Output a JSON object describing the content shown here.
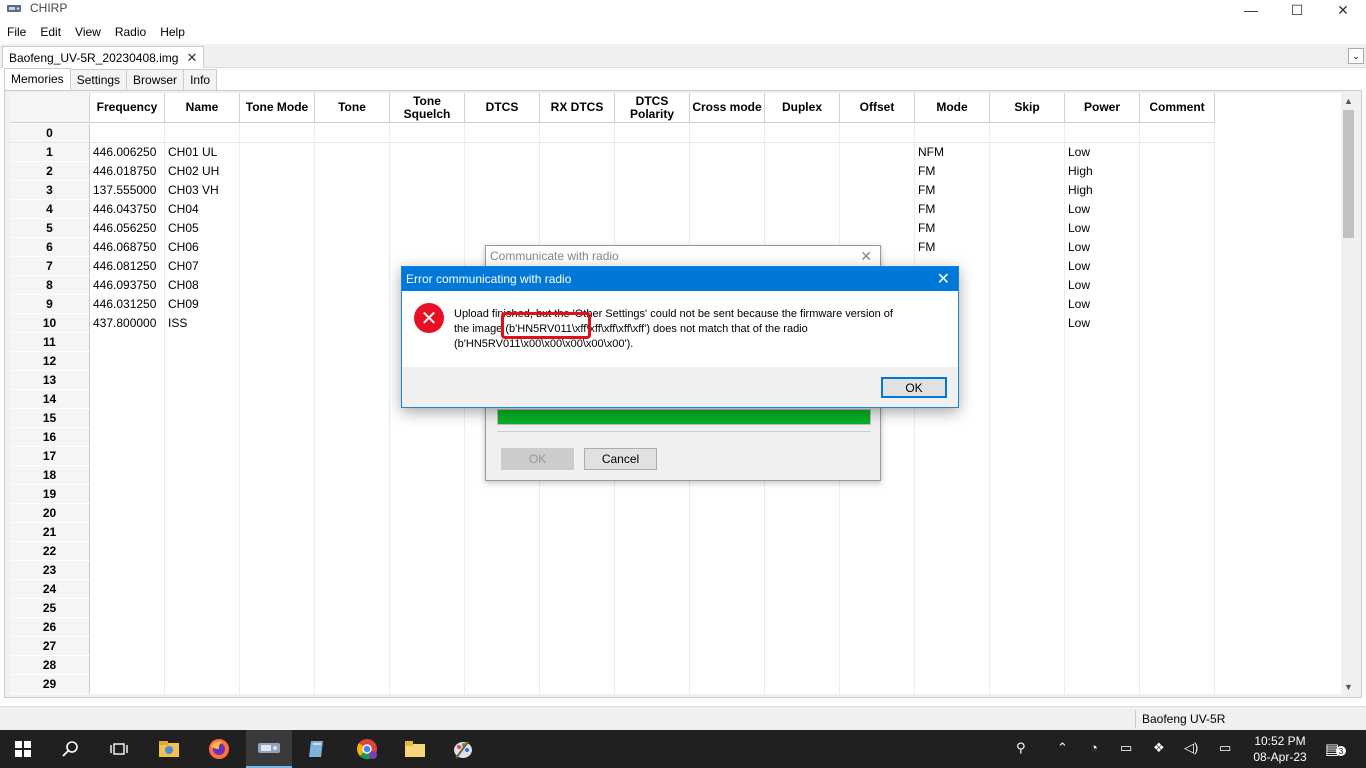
{
  "window": {
    "title": "CHIRP",
    "minimize": "—",
    "maximize": "☐",
    "close": "✕"
  },
  "menu": [
    "File",
    "Edit",
    "View",
    "Radio",
    "Help"
  ],
  "document_tab": {
    "label": "Baofeng_UV-5R_20230408.img",
    "close": "✕",
    "dropdown": "⌄"
  },
  "tabs": [
    "Memories",
    "Settings",
    "Browser",
    "Info"
  ],
  "grid": {
    "columns": [
      "Frequency",
      "Name",
      "Tone Mode",
      "Tone",
      "Tone Squelch",
      "DTCS",
      "RX DTCS",
      "DTCS Polarity",
      "Cross mode",
      "Duplex",
      "Offset",
      "Mode",
      "Skip",
      "Power",
      "Comment"
    ],
    "rows": [
      {
        "num": "0",
        "frequency": "",
        "name": "",
        "mode": "",
        "power": ""
      },
      {
        "num": "1",
        "frequency": "446.006250",
        "name": "CH01 UL",
        "mode": "NFM",
        "power": "Low"
      },
      {
        "num": "2",
        "frequency": "446.018750",
        "name": "CH02 UH",
        "mode": "FM",
        "power": "High"
      },
      {
        "num": "3",
        "frequency": "137.555000",
        "name": "CH03 VH",
        "mode": "FM",
        "power": "High"
      },
      {
        "num": "4",
        "frequency": "446.043750",
        "name": "CH04",
        "mode": "FM",
        "power": "Low"
      },
      {
        "num": "5",
        "frequency": "446.056250",
        "name": "CH05",
        "mode": "FM",
        "power": "Low"
      },
      {
        "num": "6",
        "frequency": "446.068750",
        "name": "CH06",
        "mode": "FM",
        "power": "Low"
      },
      {
        "num": "7",
        "frequency": "446.081250",
        "name": "CH07",
        "mode": "",
        "power": "Low"
      },
      {
        "num": "8",
        "frequency": "446.093750",
        "name": "CH08",
        "mode": "",
        "power": "Low"
      },
      {
        "num": "9",
        "frequency": "446.031250",
        "name": "CH09",
        "mode": "",
        "power": "Low"
      },
      {
        "num": "10",
        "frequency": "437.800000",
        "name": "ISS",
        "mode": "",
        "power": "Low"
      },
      {
        "num": "11",
        "frequency": "",
        "name": "",
        "mode": "",
        "power": ""
      },
      {
        "num": "12",
        "frequency": "",
        "name": "",
        "mode": "",
        "power": ""
      },
      {
        "num": "13",
        "frequency": "",
        "name": "",
        "mode": "",
        "power": ""
      },
      {
        "num": "14",
        "frequency": "",
        "name": "",
        "mode": "",
        "power": ""
      },
      {
        "num": "15",
        "frequency": "",
        "name": "",
        "mode": "",
        "power": ""
      },
      {
        "num": "16",
        "frequency": "",
        "name": "",
        "mode": "",
        "power": ""
      },
      {
        "num": "17",
        "frequency": "",
        "name": "",
        "mode": "",
        "power": ""
      },
      {
        "num": "18",
        "frequency": "",
        "name": "",
        "mode": "",
        "power": ""
      },
      {
        "num": "19",
        "frequency": "",
        "name": "",
        "mode": "",
        "power": ""
      },
      {
        "num": "20",
        "frequency": "",
        "name": "",
        "mode": "",
        "power": ""
      },
      {
        "num": "21",
        "frequency": "",
        "name": "",
        "mode": "",
        "power": ""
      },
      {
        "num": "22",
        "frequency": "",
        "name": "",
        "mode": "",
        "power": ""
      },
      {
        "num": "23",
        "frequency": "",
        "name": "",
        "mode": "",
        "power": ""
      },
      {
        "num": "24",
        "frequency": "",
        "name": "",
        "mode": "",
        "power": ""
      },
      {
        "num": "25",
        "frequency": "",
        "name": "",
        "mode": "",
        "power": ""
      },
      {
        "num": "26",
        "frequency": "",
        "name": "",
        "mode": "",
        "power": ""
      },
      {
        "num": "27",
        "frequency": "",
        "name": "",
        "mode": "",
        "power": ""
      },
      {
        "num": "28",
        "frequency": "",
        "name": "",
        "mode": "",
        "power": ""
      },
      {
        "num": "29",
        "frequency": "",
        "name": "",
        "mode": "",
        "power": ""
      }
    ]
  },
  "progress_dialog": {
    "title": "Communicate with radio",
    "close": "✕",
    "progress": 1.0,
    "ok_label": "OK",
    "cancel_label": "Cancel"
  },
  "error_dialog": {
    "title": "Error communicating with radio",
    "close": "✕",
    "icon": "✕",
    "message_line1": "Upload finished, but the 'Other Settings' could not be sent because the firmware version of",
    "message_line2": "the image (b'HN5RV011\\xff\\xff\\xff\\xff\\xff') does not match that of the radio",
    "message_line3": "(b'HN5RV011\\x00\\x00\\x00\\x00\\x00').",
    "ok_label": "OK"
  },
  "statusbar": {
    "radio": "Baofeng UV-5R"
  },
  "taskbar": {
    "time": "10:52 PM",
    "date": "08-Apr-23",
    "notifications": "3"
  },
  "colors": {
    "titlebar_accent": "#0078d7",
    "progress_fill": "#06b025",
    "error_icon": "#e81123",
    "annotation": "#e0101a"
  }
}
